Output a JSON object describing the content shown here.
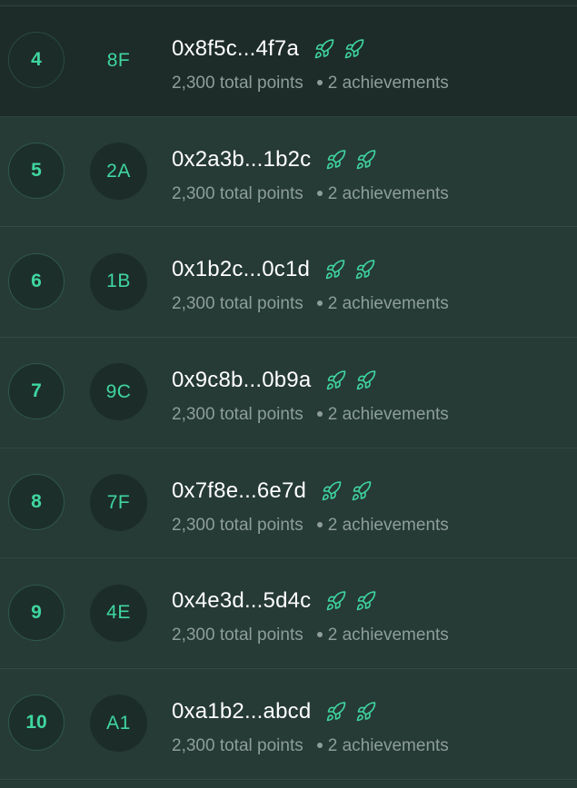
{
  "leaderboard": {
    "rows": [
      {
        "rank": "4",
        "avatar": "8F",
        "address": "0x8f5c...4f7a",
        "points": "2,300 total points",
        "achievements": "2 achievements",
        "badges": [
          "rocket-icon",
          "rocket-icon"
        ],
        "highlighted": true
      },
      {
        "rank": "5",
        "avatar": "2A",
        "address": "0x2a3b...1b2c",
        "points": "2,300 total points",
        "achievements": "2 achievements",
        "badges": [
          "rocket-icon",
          "rocket-icon"
        ],
        "highlighted": false
      },
      {
        "rank": "6",
        "avatar": "1B",
        "address": "0x1b2c...0c1d",
        "points": "2,300 total points",
        "achievements": "2 achievements",
        "badges": [
          "rocket-icon",
          "rocket-icon"
        ],
        "highlighted": false
      },
      {
        "rank": "7",
        "avatar": "9C",
        "address": "0x9c8b...0b9a",
        "points": "2,300 total points",
        "achievements": "2 achievements",
        "badges": [
          "rocket-icon",
          "rocket-icon"
        ],
        "highlighted": false
      },
      {
        "rank": "8",
        "avatar": "7F",
        "address": "0x7f8e...6e7d",
        "points": "2,300 total points",
        "achievements": "2 achievements",
        "badges": [
          "rocket-icon",
          "rocket-icon"
        ],
        "highlighted": false
      },
      {
        "rank": "9",
        "avatar": "4E",
        "address": "0x4e3d...5d4c",
        "points": "2,300 total points",
        "achievements": "2 achievements",
        "badges": [
          "rocket-icon",
          "rocket-icon"
        ],
        "highlighted": false
      },
      {
        "rank": "10",
        "avatar": "A1",
        "address": "0xa1b2...abcd",
        "points": "2,300 total points",
        "achievements": "2 achievements",
        "badges": [
          "rocket-icon",
          "rocket-icon"
        ],
        "highlighted": false
      }
    ]
  },
  "colors": {
    "accent": "#3fd6a0",
    "row_background": "#263a36",
    "highlight_background": "#1d2c29",
    "text_primary": "#ffffff",
    "text_secondary": "#8e9e99"
  }
}
